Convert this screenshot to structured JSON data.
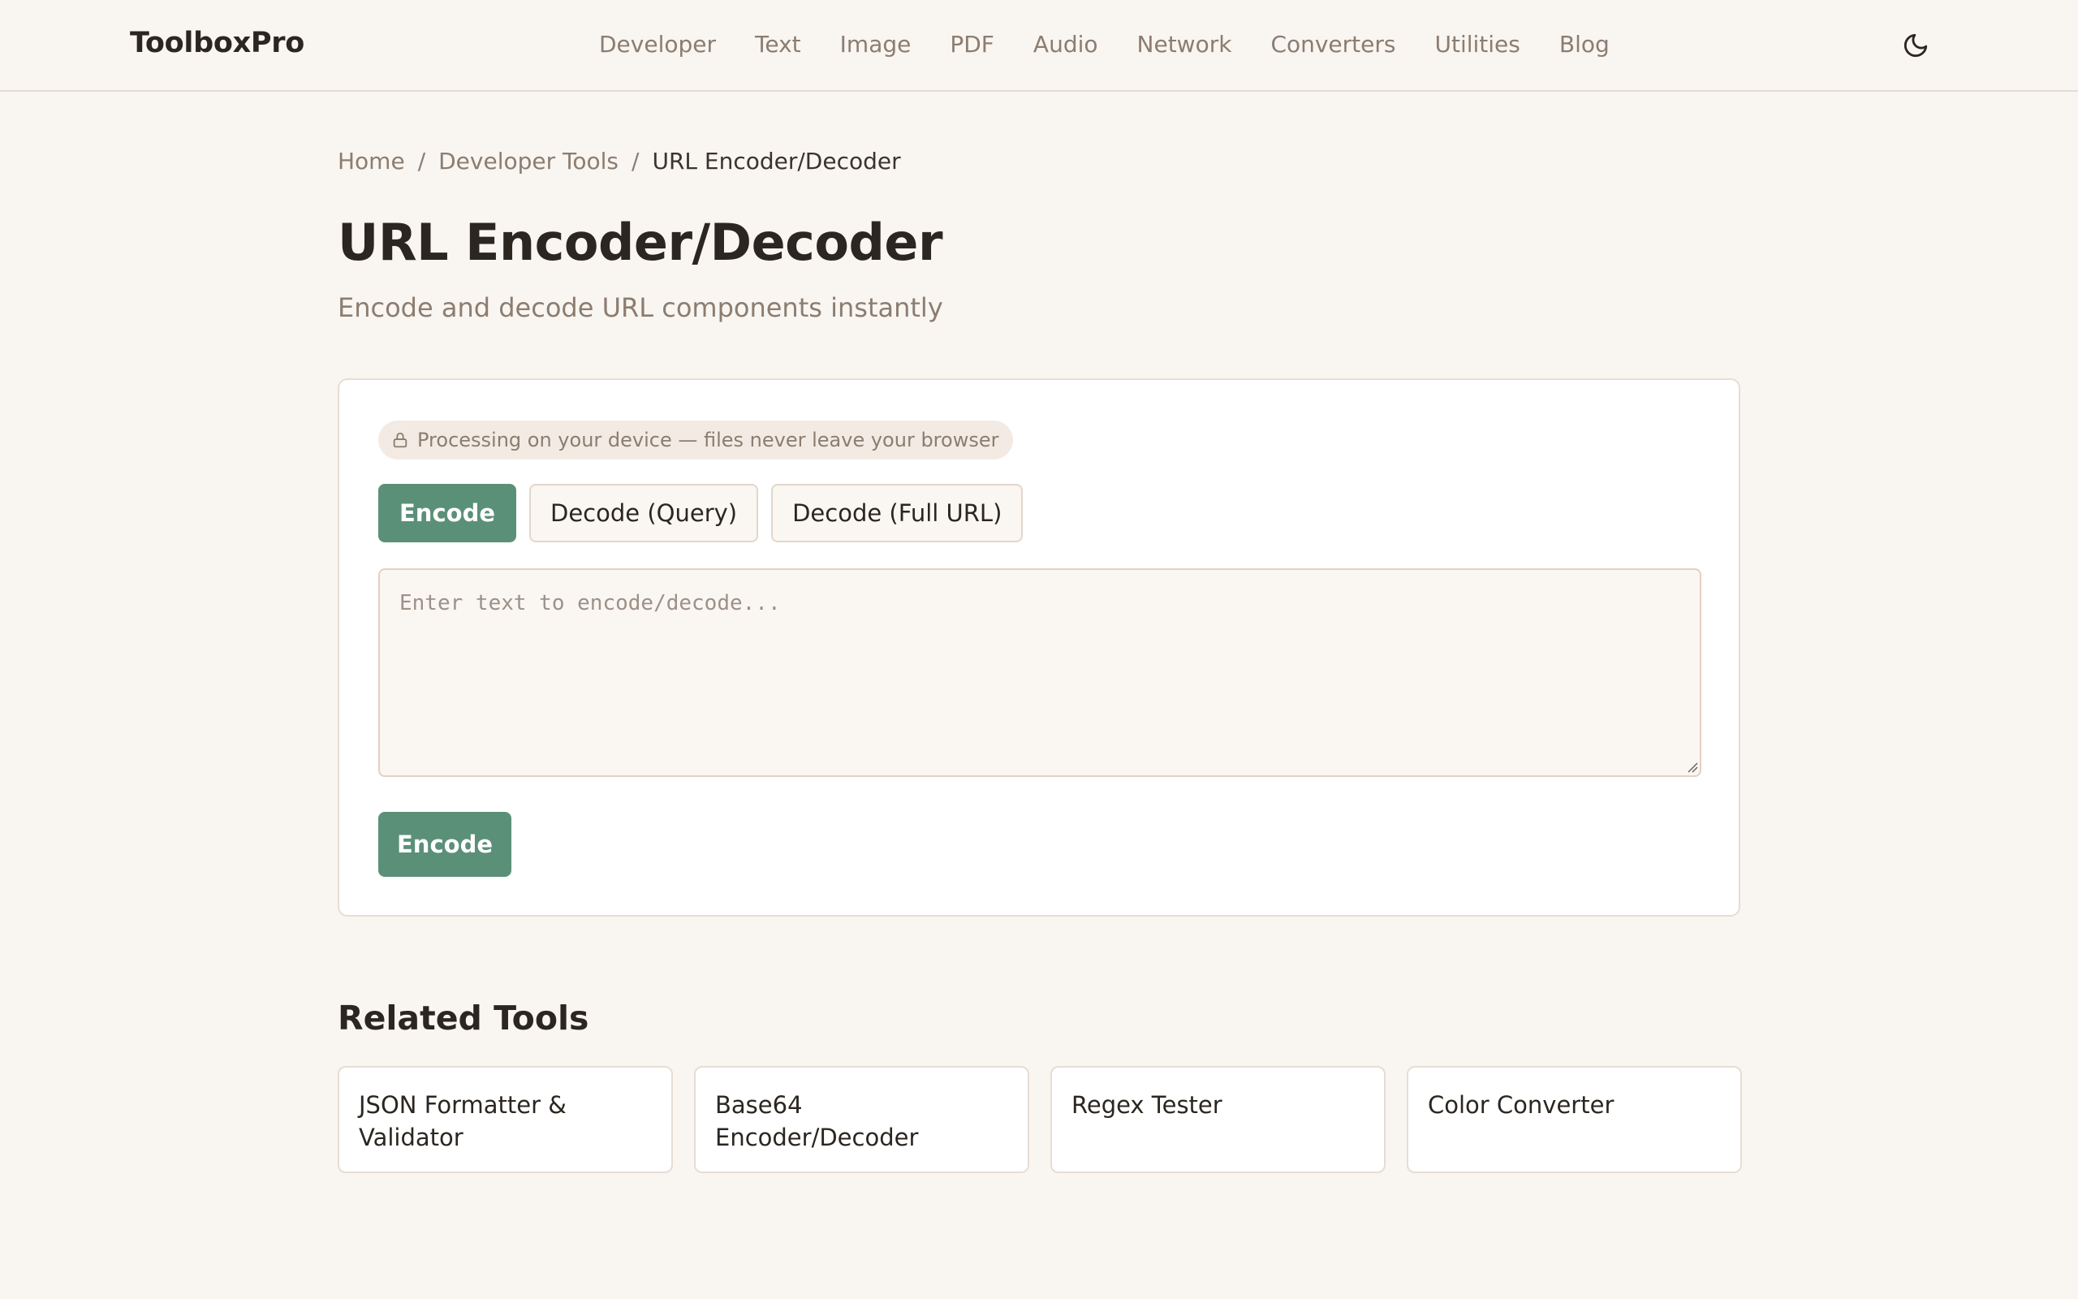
{
  "header": {
    "brand": "ToolboxPro",
    "nav": [
      "Developer",
      "Text",
      "Image",
      "PDF",
      "Audio",
      "Network",
      "Converters",
      "Utilities",
      "Blog"
    ],
    "theme_icon": "moon-icon"
  },
  "breadcrumb": {
    "home": "Home",
    "sep": "/",
    "section": "Developer Tools",
    "current": "URL Encoder/Decoder"
  },
  "page": {
    "title": "URL Encoder/Decoder",
    "subtitle": "Encode and decode URL components instantly"
  },
  "tool": {
    "privacy_icon": "lock-icon",
    "privacy_note": "Processing on your device — files never leave your browser",
    "tabs": [
      {
        "label": "Encode",
        "active": true
      },
      {
        "label": "Decode (Query)",
        "active": false
      },
      {
        "label": "Decode (Full URL)",
        "active": false
      }
    ],
    "input_placeholder": "Enter text to encode/decode...",
    "input_value": "",
    "action_label": "Encode",
    "accent_color": "#5b9078"
  },
  "related": {
    "heading": "Related Tools",
    "items": [
      "JSON Formatter & Validator",
      "Base64 Encoder/Decoder",
      "Regex Tester",
      "Color Converter"
    ]
  }
}
